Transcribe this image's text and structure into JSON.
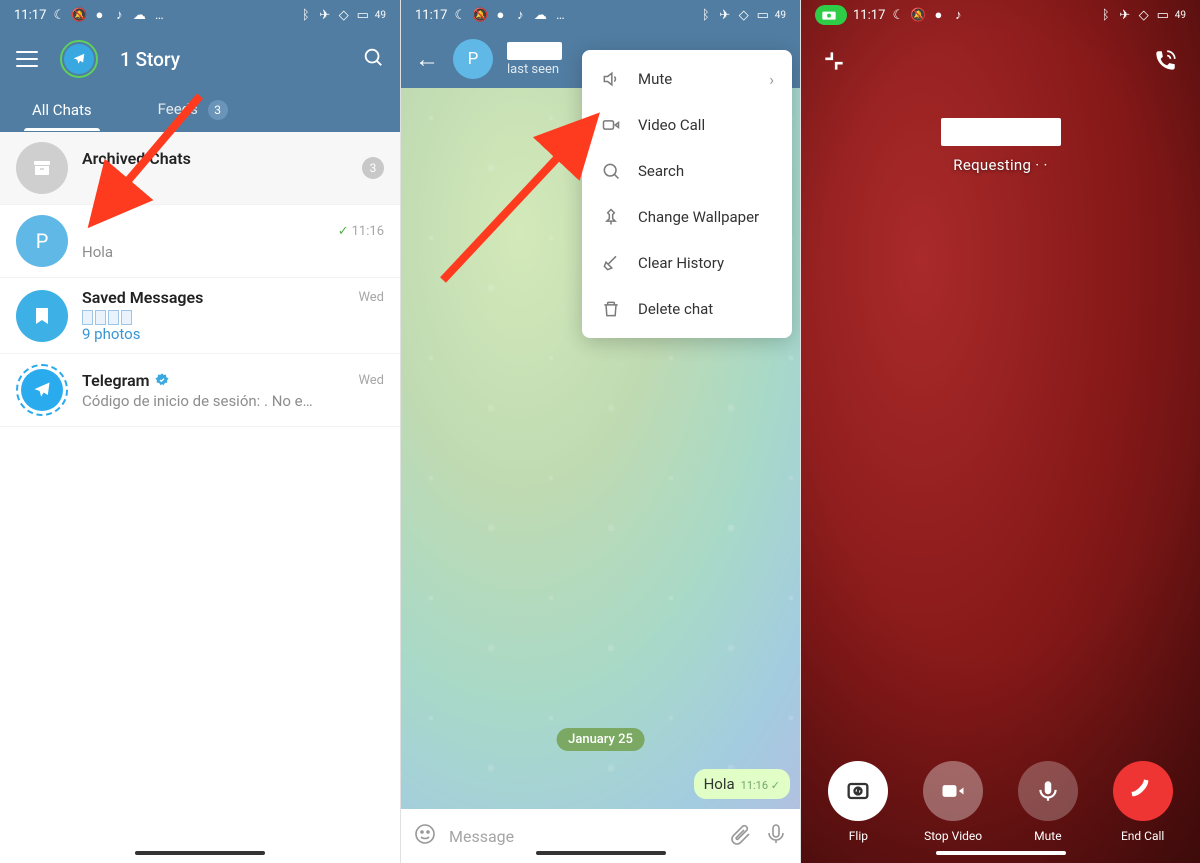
{
  "status": {
    "time": "11:17",
    "battery": "49"
  },
  "phone1": {
    "header": {
      "title": "1 Story"
    },
    "tabs": {
      "all": "All Chats",
      "feeds": "Feeds",
      "feeds_count": "3"
    },
    "archived": {
      "title": "Archived Chats",
      "badge": "3"
    },
    "chats": [
      {
        "name": "",
        "message": "Hola",
        "time": "11:16",
        "check": true,
        "avatar": "P"
      },
      {
        "name": "Saved Messages",
        "photos_count": "9 photos",
        "time": "Wed"
      },
      {
        "name": "Telegram",
        "message": "Código de inicio de sesión:          . No e…",
        "time": "Wed",
        "verified": true
      }
    ]
  },
  "phone2": {
    "last_seen": "last seen",
    "menu": {
      "mute": "Mute",
      "video_call": "Video Call",
      "search": "Search",
      "wallpaper": "Change Wallpaper",
      "clear": "Clear History",
      "delete": "Delete chat"
    },
    "date_label": "January 25",
    "message": {
      "text": "Hola",
      "time": "11:16"
    },
    "compose_placeholder": "Message"
  },
  "phone3": {
    "status": "Requesting",
    "controls": {
      "flip": "Flip",
      "stop_video": "Stop Video",
      "mute": "Mute",
      "end_call": "End Call"
    }
  }
}
